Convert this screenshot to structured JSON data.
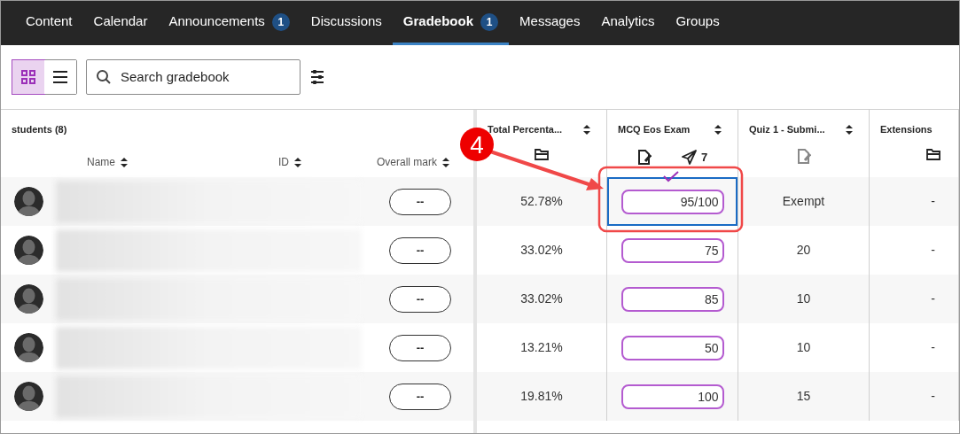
{
  "tabs": [
    {
      "label": "Content",
      "selected": false
    },
    {
      "label": "Calendar",
      "selected": false
    },
    {
      "label": "Announcements",
      "badge": "1",
      "selected": false
    },
    {
      "label": "Discussions",
      "selected": false
    },
    {
      "label": "Gradebook",
      "badge": "1",
      "selected": true
    },
    {
      "label": "Messages",
      "selected": false
    },
    {
      "label": "Analytics",
      "selected": false
    },
    {
      "label": "Groups",
      "selected": false
    }
  ],
  "view_toggle": [
    {
      "kind": "grid",
      "selected": true
    },
    {
      "kind": "list",
      "selected": false
    }
  ],
  "search": {
    "placeholder": "Search gradebook"
  },
  "students_header": "students (8)",
  "student_columns": [
    "Name",
    "ID",
    "Overall mark"
  ],
  "grade_columns": [
    {
      "title": "Total Percenta...",
      "icons": [
        {
          "kind": "folder",
          "enabled": true
        }
      ]
    },
    {
      "title": "MCQ Eos Exam",
      "icons": [
        {
          "kind": "document",
          "enabled": true
        },
        {
          "kind": "send",
          "enabled": true,
          "count": "7"
        }
      ]
    },
    {
      "title": "Quiz 1 - Submi...",
      "icons": [
        {
          "kind": "document",
          "enabled": false
        }
      ]
    },
    {
      "title": "Extensions",
      "icons": [
        {
          "kind": "folder",
          "enabled": true
        }
      ]
    }
  ],
  "rows": [
    {
      "overall": "--",
      "total": "52.78%",
      "mcq": "95/100",
      "quiz": "Exempt",
      "extensions": "-",
      "focused": true
    },
    {
      "overall": "--",
      "total": "33.02%",
      "mcq": "75",
      "quiz": "20",
      "extensions": "-",
      "focused": false
    },
    {
      "overall": "--",
      "total": "33.02%",
      "mcq": "85",
      "quiz": "10",
      "extensions": "-",
      "focused": false
    },
    {
      "overall": "--",
      "total": "13.21%",
      "mcq": "50",
      "quiz": "10",
      "extensions": "-",
      "focused": false
    },
    {
      "overall": "--",
      "total": "19.81%",
      "mcq": "100",
      "quiz": "15",
      "extensions": "-",
      "focused": false
    }
  ],
  "callout": {
    "number": "4"
  }
}
